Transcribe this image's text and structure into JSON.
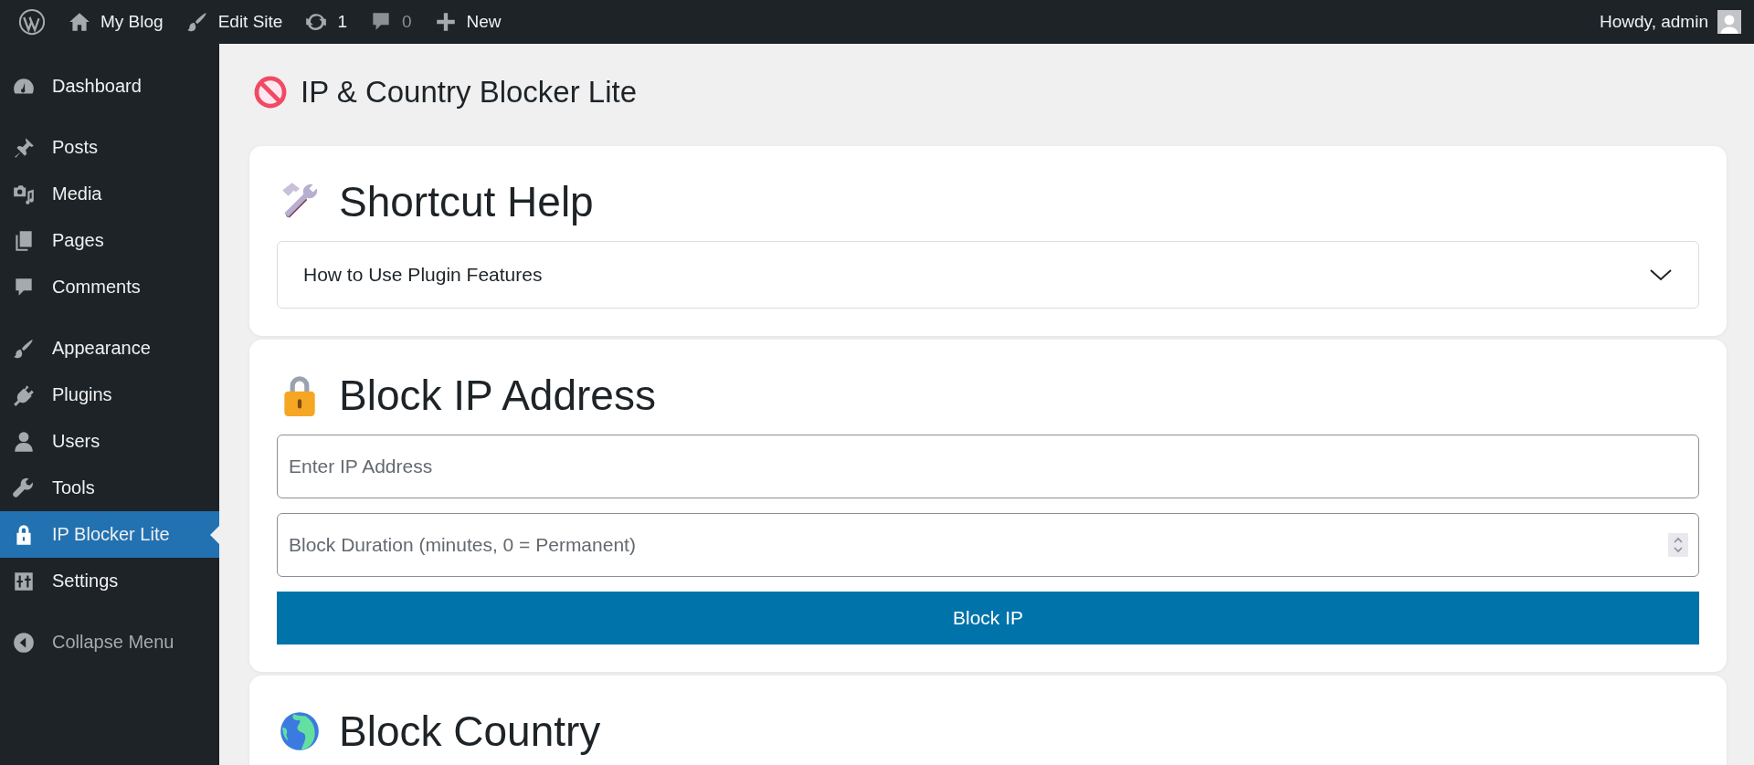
{
  "admin_bar": {
    "items": [
      {
        "label": "My Blog",
        "kind": "home"
      },
      {
        "label": "Edit Site",
        "kind": "brush"
      },
      {
        "label": "1",
        "kind": "updates"
      },
      {
        "label": "0",
        "kind": "comments"
      },
      {
        "label": "New",
        "kind": "plus"
      }
    ],
    "greeting": "Howdy, admin"
  },
  "sidebar": {
    "groups": [
      [
        {
          "label": "Dashboard",
          "selected": false
        }
      ],
      [
        {
          "label": "Posts",
          "selected": false
        },
        {
          "label": "Media",
          "selected": false
        },
        {
          "label": "Pages",
          "selected": false
        },
        {
          "label": "Comments",
          "selected": false
        }
      ],
      [
        {
          "label": "Appearance",
          "selected": false
        },
        {
          "label": "Plugins",
          "selected": false
        },
        {
          "label": "Users",
          "selected": false
        },
        {
          "label": "Tools",
          "selected": false
        },
        {
          "label": "IP Blocker Lite",
          "selected": true
        },
        {
          "label": "Settings",
          "selected": false
        }
      ]
    ],
    "collapse": "Collapse Menu"
  },
  "page_title": "IP & Country Blocker Lite",
  "cards": [
    {
      "kind": "help",
      "title": "Shortcut Help",
      "accordion": {
        "label": "How to Use Plugin Features",
        "expanded": false
      }
    },
    {
      "kind": "ip",
      "title": "Block IP Address",
      "ip_field": {
        "placeholder": "Enter IP Address"
      },
      "duration_field": {
        "placeholder": "Block Duration (minutes, 0 = Permanent)"
      },
      "button": "Block IP"
    },
    {
      "kind": "country",
      "title": "Block Country"
    }
  ]
}
